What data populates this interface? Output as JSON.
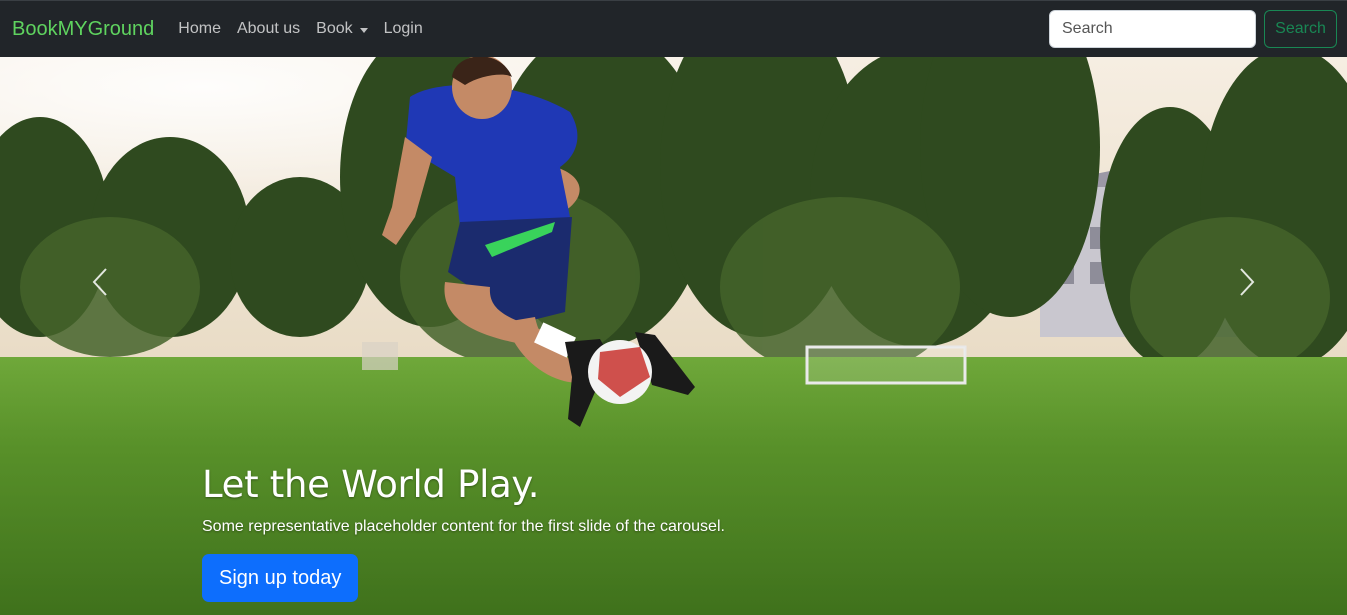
{
  "navbar": {
    "brand": "BookMYGround",
    "links": [
      "Home",
      "About us",
      "Book",
      "Login"
    ],
    "search_placeholder": "Search",
    "search_button": "Search"
  },
  "hero": {
    "title": "Let the World Play.",
    "subtitle": "Some representative placeholder content for the first slide of the carousel.",
    "cta": "Sign up today"
  },
  "colors": {
    "navbar_bg": "#212529",
    "brand": "#5fd35f",
    "search_button": "#198754",
    "cta": "#0d6efd"
  },
  "icons": [
    "chevron-left-icon",
    "chevron-right-icon",
    "caret-down-icon"
  ]
}
